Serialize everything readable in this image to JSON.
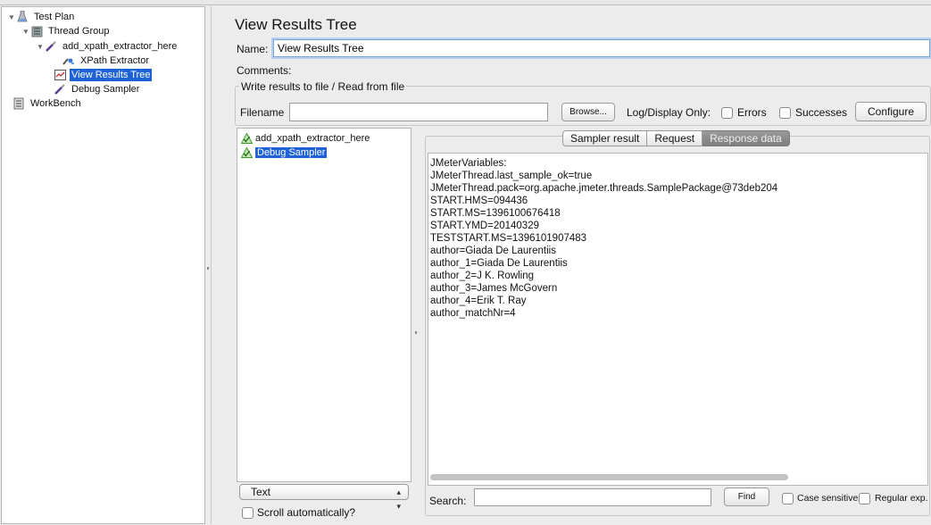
{
  "tree": {
    "items": [
      {
        "label": "Test Plan",
        "icon": "test-plan-icon"
      },
      {
        "label": "Thread Group",
        "icon": "thread-group-icon"
      },
      {
        "label": "add_xpath_extractor_here",
        "icon": "sampler-icon"
      },
      {
        "label": "XPath Extractor",
        "icon": "extractor-icon"
      },
      {
        "label": "View Results Tree",
        "icon": "listener-icon",
        "selected": true
      },
      {
        "label": "Debug Sampler",
        "icon": "sampler-icon"
      },
      {
        "label": "WorkBench",
        "icon": "workbench-icon"
      }
    ]
  },
  "panel": {
    "title": "View Results Tree",
    "name_label": "Name:",
    "name_value": "View Results Tree",
    "comments_label": "Comments:"
  },
  "file_section": {
    "legend": "Write results to file / Read from file",
    "filename_label": "Filename",
    "filename_value": "",
    "browse_label": "Browse...",
    "log_display_label": "Log/Display Only:",
    "errors_label": "Errors",
    "successes_label": "Successes",
    "configure_label": "Configure"
  },
  "results": {
    "items": [
      {
        "label": "add_xpath_extractor_here",
        "status": "success",
        "selected": false
      },
      {
        "label": "Debug Sampler",
        "status": "success",
        "selected": true
      }
    ],
    "renderer_value": "Text",
    "scroll_label": "Scroll automatically?"
  },
  "tabs": [
    {
      "label": "Sampler result",
      "active": false
    },
    {
      "label": "Request",
      "active": false
    },
    {
      "label": "Response data",
      "active": true
    }
  ],
  "response_lines": [
    "JMeterVariables:",
    "JMeterThread.last_sample_ok=true",
    "JMeterThread.pack=org.apache.jmeter.threads.SamplePackage@73deb204",
    "START.HMS=094436",
    "START.MS=1396100676418",
    "START.YMD=20140329",
    "TESTSTART.MS=1396101907483",
    "author=Giada De Laurentiis",
    "author_1=Giada De Laurentiis",
    "author_2=J K. Rowling",
    "author_3=James McGovern",
    "author_4=Erik T. Ray",
    "author_matchNr=4"
  ],
  "search": {
    "label": "Search:",
    "value": "",
    "find_label": "Find",
    "case_sensitive_label": "Case sensitive",
    "regex_label": "Regular exp."
  },
  "colors": {
    "selection": "#1f62d6",
    "success_icon": "#3a9a2a"
  }
}
